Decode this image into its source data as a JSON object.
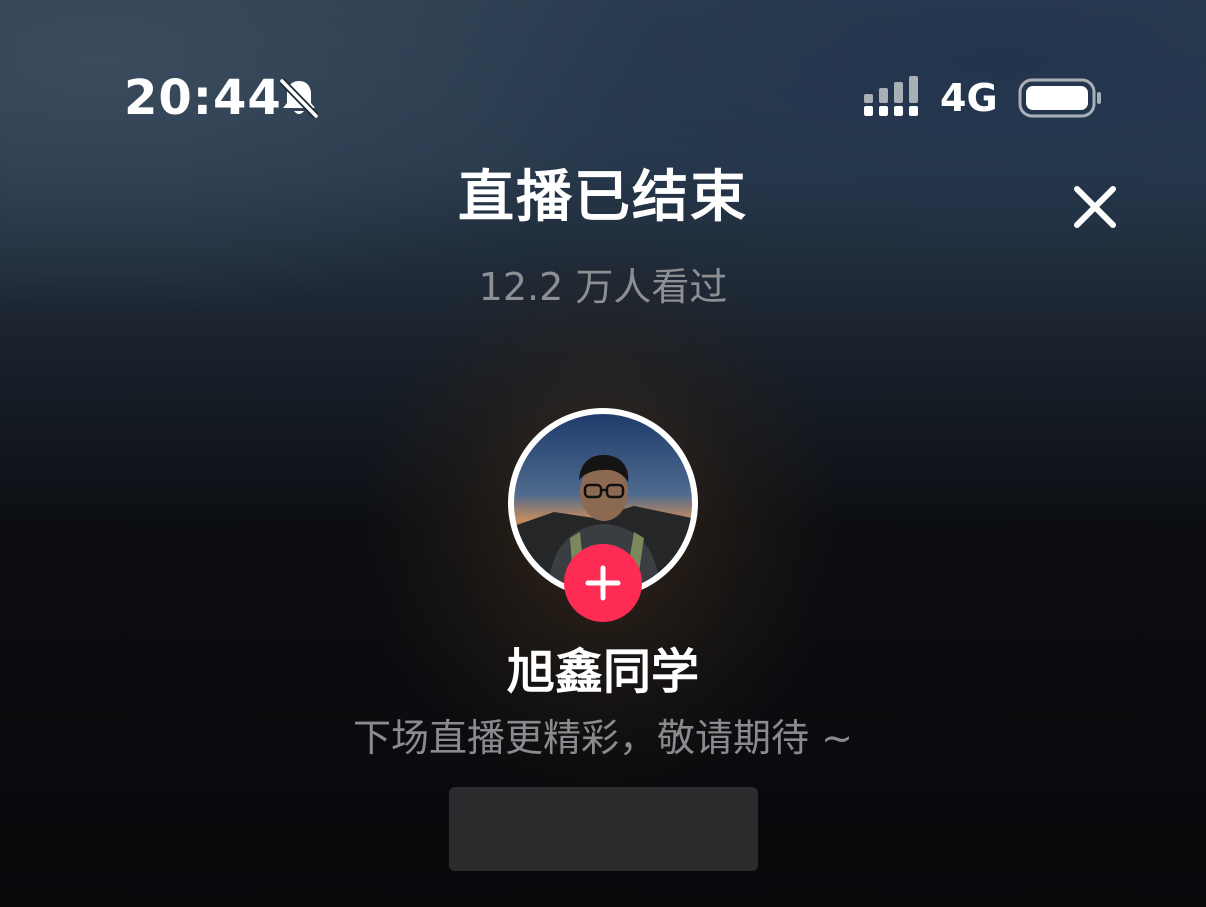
{
  "status_bar": {
    "time": "20:44",
    "network": "4G",
    "icons": [
      "bell-muted-icon",
      "signal-icon",
      "battery-icon"
    ]
  },
  "header": {
    "title": "直播已结束",
    "viewers": "12.2 万人看过",
    "close_icon": "close-icon"
  },
  "streamer": {
    "name": "旭鑫同学",
    "follow_icon": "plus-icon"
  },
  "message": "下场直播更精彩，敬请期待 ~",
  "colors": {
    "accent": "#fe2c55",
    "text_primary": "#ffffff",
    "text_secondary": "#8e8f93",
    "button_bg": "#2c2c2f"
  }
}
